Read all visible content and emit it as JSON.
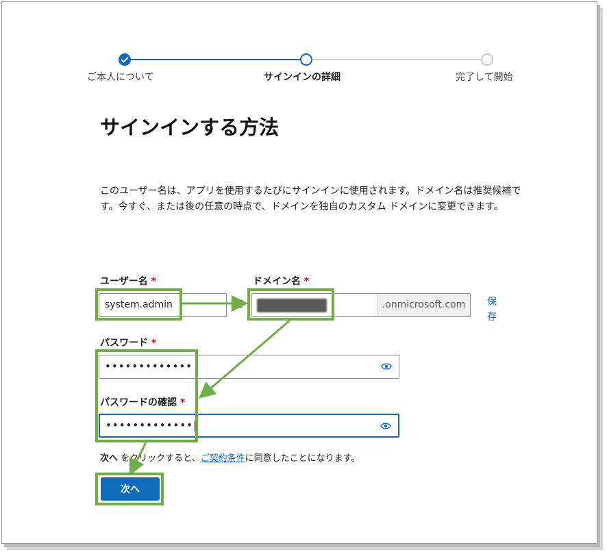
{
  "stepper": {
    "steps": [
      {
        "label": "ご本人について",
        "state": "done"
      },
      {
        "label": "サインインの詳細",
        "state": "current"
      },
      {
        "label": "完了して開始",
        "state": "future"
      }
    ]
  },
  "page": {
    "title": "サインインする方法",
    "description": "このユーザー名は、アプリを使用するたびにサインインに使用されます。ドメイン名は推奨候補です。今すぐ、または後の任意の時点で、ドメインを独自のカスタム ドメインに変更できます。"
  },
  "form": {
    "username_label": "ユーザー名",
    "username_value": "system.admin",
    "at_symbol": "@",
    "domain_label": "ドメイン名",
    "domain_suffix": ".onmicrosoft.com",
    "save_link": "保存",
    "password_label": "パスワード",
    "password_value": "•••••••••••••",
    "confirm_label": "パスワードの確認",
    "confirm_value": "•••••••••••••|",
    "required_mark": "*"
  },
  "footer": {
    "terms_bold": "次へ",
    "terms_pre": " をクリックすると、",
    "terms_link": "ご契約条件",
    "terms_post": "に同意したことになります。",
    "next_button": "次へ"
  },
  "colors": {
    "accent": "#0f6cbd",
    "highlight": "#70ad47",
    "required": "#c50f1f"
  }
}
